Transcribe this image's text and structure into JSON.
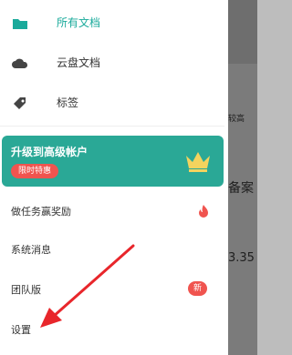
{
  "nav": [
    {
      "label": "所有文档",
      "icon": "folder-icon",
      "active": true
    },
    {
      "label": "云盘文档",
      "icon": "cloud-icon",
      "active": false
    },
    {
      "label": "标签",
      "icon": "tag-icon",
      "active": false
    }
  ],
  "promo": {
    "title": "升级到高级帐户",
    "badge": "限时特惠",
    "icon": "crown-icon"
  },
  "menu": [
    {
      "label": "做任务赢奖励",
      "icon": "fire-icon"
    },
    {
      "label": "系统消息"
    },
    {
      "label": "团队版",
      "badge": "新"
    },
    {
      "label": "设置"
    }
  ],
  "background": {
    "text1": "较高",
    "text2": "备案",
    "text3": "3.35"
  },
  "colors": {
    "accent": "#1aaa9b",
    "promo": "#2aa896",
    "badge": "#f0544f",
    "annotation": "#e8262b"
  }
}
